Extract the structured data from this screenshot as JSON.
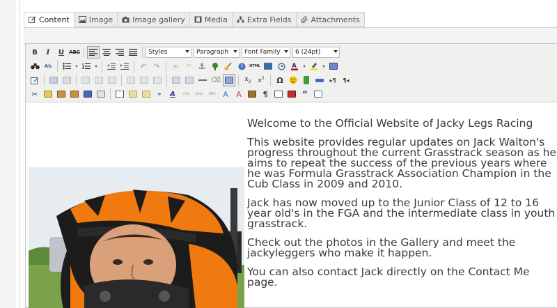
{
  "tabs": [
    {
      "label": "Content",
      "icon": "edit-icon",
      "active": true
    },
    {
      "label": "Image",
      "icon": "image-icon",
      "active": false
    },
    {
      "label": "Image gallery",
      "icon": "camera-icon",
      "active": false
    },
    {
      "label": "Media",
      "icon": "film-icon",
      "active": false
    },
    {
      "label": "Extra Fields",
      "icon": "sitemap-icon",
      "active": false
    },
    {
      "label": "Attachments",
      "icon": "paperclip-icon",
      "active": false
    }
  ],
  "toolbar": {
    "styles": "Styles",
    "format": "Paragraph",
    "font_family": "Font Family",
    "font_size": "6 (24pt)"
  },
  "content": {
    "title": "Welcome to the Official Website of Jacky Legs Racing",
    "p1": "This website provides regular updates on Jack Walton's progress throughout the  current Grasstrack season as he aims to repeat the success of the previous years  where he was Formula Grasstrack Association Champion in the Cub Class in 2009 and 2010.",
    "p2": "Jack has now moved up to the Junior Class of 12 to 16 year old's in the FGA and the intermediate class in youth grasstrack.",
    "p3": "Check out the photos in the Gallery and meet the jackyleggers who make it happen.",
    "p4": "You can also contact Jack directly on the Contact Me page."
  },
  "colors": {
    "helmet_orange": "#f07a10",
    "helmet_black": "#1c1c1c",
    "grass": "#7aa24a",
    "sky": "#e8eef2"
  }
}
